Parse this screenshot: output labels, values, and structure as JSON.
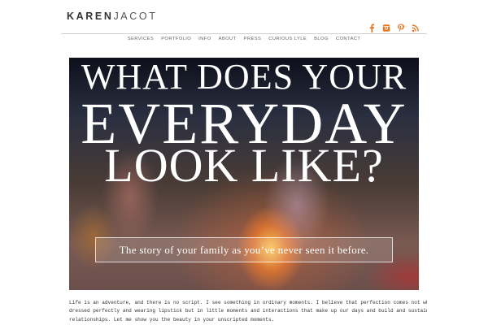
{
  "header": {
    "logo_first": "KAREN",
    "logo_last": "JACOT",
    "social": [
      {
        "icon": "facebook-icon",
        "color": "#e87722"
      },
      {
        "icon": "instagram-icon",
        "color": "#e87722"
      },
      {
        "icon": "pinterest-icon",
        "color": "#e87722"
      },
      {
        "icon": "rss-icon",
        "color": "#e87722"
      }
    ]
  },
  "nav": {
    "items": [
      "SERVICES",
      "PORTFOLIO",
      "INFO",
      "ABOUT",
      "PRESS",
      "CURIOUS LYLE",
      "BLOG",
      "CONTACT"
    ]
  },
  "hero": {
    "line1": "WHAT DOES YOUR",
    "line2": "EVERYDAY",
    "line3": "LOOK LIKE?",
    "tagline": "The story of your family as you’ve never seen it before."
  },
  "intro": {
    "lines": [
      "Life is an adventure, and there is no script. I see something in ordinary moments. I believe that perfection comes not when yo",
      "dressed perfectly and wearing lipstick but in little moments and interactions that make up our days and build and sustain our",
      "relationships. Let me show you the beauty in your unscripted moments."
    ]
  },
  "colors": {
    "accent": "#e87722",
    "text": "#333333"
  }
}
